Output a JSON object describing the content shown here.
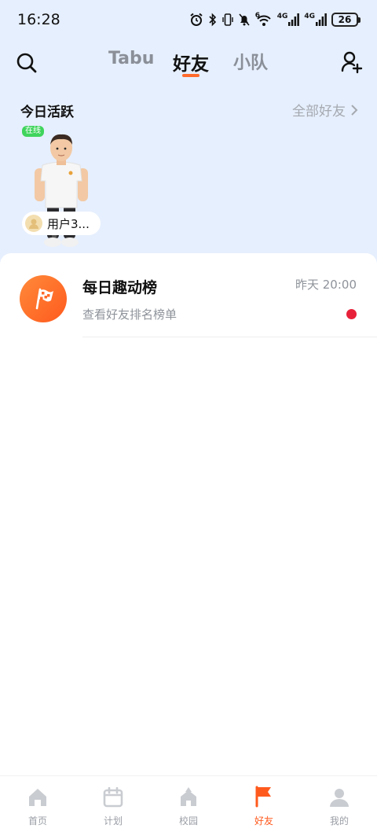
{
  "status_bar": {
    "time": "16:28",
    "net1": "4G",
    "net2": "4G",
    "wifi_badge": "6",
    "battery": "26"
  },
  "header": {
    "tabs": [
      {
        "label": "Tabu"
      },
      {
        "label": "好友"
      },
      {
        "label": "小队"
      }
    ],
    "active_tab": "好友"
  },
  "today_active": {
    "title": "今日活跃",
    "all_friends_label": "全部好友",
    "friends": [
      {
        "status": "在线",
        "name": "用户3..."
      }
    ]
  },
  "list": {
    "items": [
      {
        "title": "每日趣动榜",
        "subtitle": "查看好友排名榜单",
        "time": "昨天 20:00",
        "unread": true
      }
    ]
  },
  "bottom_nav": {
    "items": [
      {
        "label": "首页",
        "icon": "home-icon"
      },
      {
        "label": "计划",
        "icon": "calendar-icon"
      },
      {
        "label": "校园",
        "icon": "campus-icon"
      },
      {
        "label": "好友",
        "icon": "flag-icon"
      },
      {
        "label": "我的",
        "icon": "person-icon"
      }
    ],
    "active": "好友"
  },
  "colors": {
    "accent": "#ff5a1e",
    "top_background": "#e6effd",
    "online_green": "#3fd45c",
    "unread_red": "#e8213a"
  }
}
